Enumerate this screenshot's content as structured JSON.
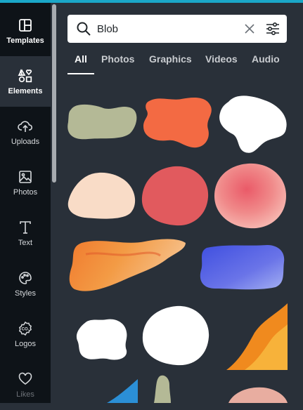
{
  "sidebar": {
    "items": [
      {
        "label": "Templates",
        "icon": "templates-icon"
      },
      {
        "label": "Elements",
        "icon": "elements-icon"
      },
      {
        "label": "Uploads",
        "icon": "upload-cloud-icon"
      },
      {
        "label": "Photos",
        "icon": "image-icon"
      },
      {
        "label": "Text",
        "icon": "text-icon"
      },
      {
        "label": "Styles",
        "icon": "palette-icon"
      },
      {
        "label": "Logos",
        "icon": "logo-badge-icon"
      },
      {
        "label": "Likes",
        "icon": "heart-icon"
      }
    ],
    "active": "Elements"
  },
  "search": {
    "value": "Blob",
    "icon": "search-icon",
    "clear_icon": "close-icon",
    "filter_icon": "filter-sliders-icon"
  },
  "tabs": [
    {
      "label": "All",
      "active": true
    },
    {
      "label": "Photos",
      "active": false
    },
    {
      "label": "Graphics",
      "active": false
    },
    {
      "label": "Videos",
      "active": false
    },
    {
      "label": "Audio",
      "active": false
    }
  ],
  "results": [
    {
      "name": "sage-blob",
      "color": "#b4b996"
    },
    {
      "name": "orange-blob",
      "color": "#f36a43"
    },
    {
      "name": "white-blob",
      "color": "#ffffff"
    },
    {
      "name": "peach-blob",
      "color": "#f9dcc7"
    },
    {
      "name": "coral-circle-blob",
      "color": "#e15a5e"
    },
    {
      "name": "pink-watercolor-blob",
      "color": "#ef7f84"
    },
    {
      "name": "orange-watercolor-stroke",
      "color": "#f18a3c"
    },
    {
      "name": "blue-watercolor-stroke",
      "color": "#5a63e0"
    },
    {
      "name": "white-rough-blob",
      "color": "#ffffff"
    },
    {
      "name": "white-round-blob",
      "color": "#ffffff"
    },
    {
      "name": "orange-wave-corner",
      "color": "#f7a22a"
    },
    {
      "name": "blue-wave-partial",
      "color": "#2b8fd6"
    },
    {
      "name": "sage-shape-partial",
      "color": "#b4b996"
    },
    {
      "name": "pink-blob-partial",
      "color": "#e8ada0"
    }
  ],
  "colors": {
    "panel_bg": "#293039",
    "sidebar_bg": "#0e1318",
    "accent": "#1aa7c8"
  }
}
